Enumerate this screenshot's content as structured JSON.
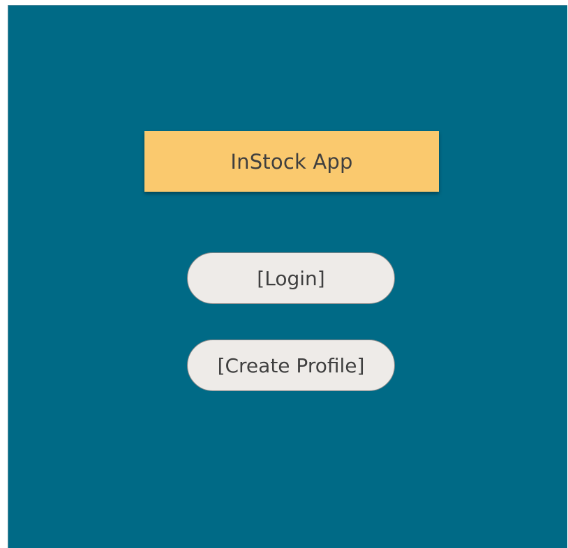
{
  "app": {
    "title": "InStock App"
  },
  "actions": {
    "login_label": "[Login]",
    "create_profile_label": "[Create Profile]"
  },
  "colors": {
    "background": "#006a86",
    "banner": "#fac96e",
    "button": "#eeebe8",
    "text": "#3f3f3f"
  }
}
